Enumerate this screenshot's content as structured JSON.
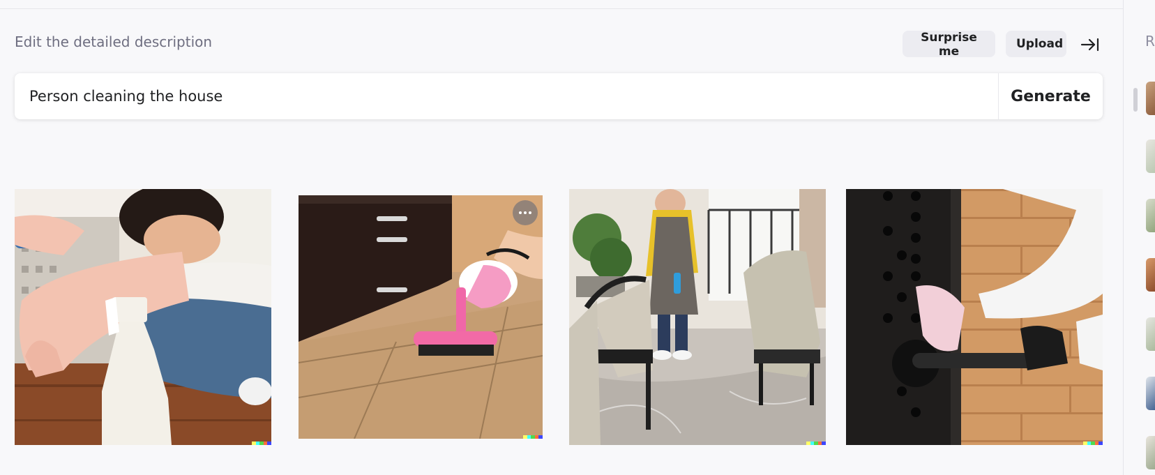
{
  "header": {
    "subtitle": "Edit the detailed description",
    "surprise_label": "Surprise me",
    "upload_label": "Upload",
    "collapse_icon": "collapse-right-icon"
  },
  "prompt": {
    "value": "Person cleaning the house",
    "generate_label": "Generate"
  },
  "results": [
    {
      "description": "man in pink gloves with spray bottle on wood floor"
    },
    {
      "description": "pink handheld vacuum on tile floor"
    },
    {
      "description": "woman in apron mopping shiny floor near chairs"
    },
    {
      "description": "gloved hand wiping black door handle"
    }
  ],
  "image_menu_icon": "more-dots-icon",
  "signature_colors": [
    "#ffff66",
    "#42ffff",
    "#51da4c",
    "#ff6e3c",
    "#3c46ff"
  ],
  "sidebar": {
    "title": "R"
  }
}
